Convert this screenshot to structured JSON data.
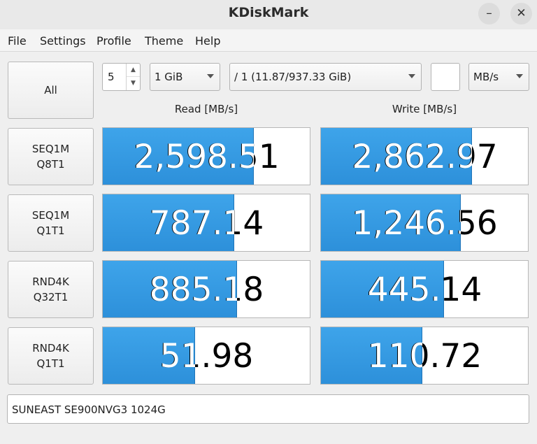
{
  "window": {
    "title": "KDiskMark"
  },
  "menu": [
    "File",
    "Settings",
    "Profile",
    "Theme",
    "Help"
  ],
  "controls": {
    "all_button": "All",
    "runs": "5",
    "size": "1 GiB",
    "target": "/ 1 (11.87/937.33 GiB)",
    "unit": "MB/s"
  },
  "headers": {
    "read": "Read [MB/s]",
    "write": "Write [MB/s]"
  },
  "tests": [
    {
      "line1": "SEQ1M",
      "line2": "Q8T1",
      "read": "2,598.51",
      "read_fill": 0.73,
      "write": "2,862.97",
      "write_fill": 0.73
    },
    {
      "line1": "SEQ1M",
      "line2": "Q1T1",
      "read": "787.14",
      "read_fill": 0.635,
      "write": "1,246.56",
      "write_fill": 0.675
    },
    {
      "line1": "RND4K",
      "line2": "Q32T1",
      "read": "885.18",
      "read_fill": 0.65,
      "write": "445.14",
      "write_fill": 0.595
    },
    {
      "line1": "RND4K",
      "line2": "Q1T1",
      "read": "51.98",
      "read_fill": 0.445,
      "write": "110.72",
      "write_fill": 0.49
    }
  ],
  "device": "SUNEAST SE900NVG3 1024G",
  "colors": {
    "bar": "#3aa0e8",
    "bar_edge": "#1f74b8"
  }
}
